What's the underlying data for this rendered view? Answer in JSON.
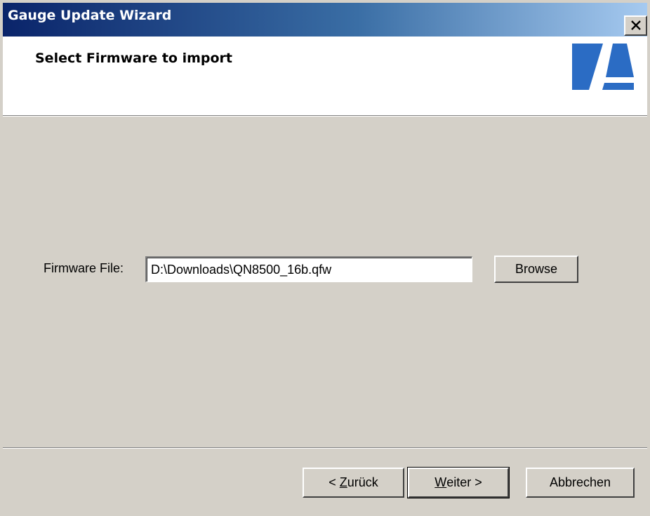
{
  "window": {
    "title": "Gauge Update Wizard",
    "close_icon": "close-x-icon"
  },
  "header": {
    "title": "Select Firmware to import",
    "logo": "brand-logo-icon",
    "logo_color": "#2b6cc4"
  },
  "form": {
    "firmware_label": "Firmware File:",
    "firmware_value": "D:\\Downloads\\QN8500_16b.qfw",
    "browse_label": "Browse"
  },
  "footer": {
    "back_prefix": "< ",
    "back_accel": "Z",
    "back_rest": "urück",
    "next_accel": "W",
    "next_rest": "eiter >",
    "cancel_label": "Abbrechen"
  },
  "colors": {
    "title_gradient_start": "#0a246a",
    "title_gradient_end": "#a6caf0",
    "dialog_bg": "#d4d0c8"
  }
}
